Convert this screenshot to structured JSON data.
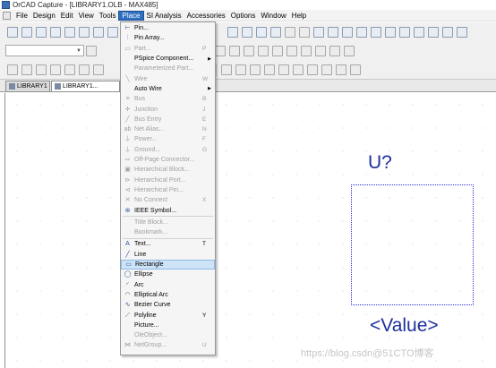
{
  "window": {
    "title": "OrCAD Capture - [LIBRARY1.OLB - MAX485]"
  },
  "menubar": [
    "File",
    "Design",
    "Edit",
    "View",
    "Tools",
    "Place",
    "SI Analysis",
    "Accessories",
    "Options",
    "Window",
    "Help"
  ],
  "tabs": [
    "LIBRARY1",
    "LIBRARY1..."
  ],
  "place_menu": [
    {
      "label": "Pin...",
      "shortcut": "",
      "enabled": true,
      "icon": "pin-icon"
    },
    {
      "label": "Pin Array...",
      "shortcut": "",
      "enabled": true,
      "icon": "pin-array-icon"
    },
    {
      "label": "Part...",
      "shortcut": "P",
      "enabled": false,
      "icon": "part-icon"
    },
    {
      "label": "PSpice Component...",
      "shortcut": "",
      "enabled": true,
      "icon": "",
      "submenu": true
    },
    {
      "label": "Parameterized Part...",
      "shortcut": "",
      "enabled": false,
      "icon": ""
    },
    {
      "label": "Wire",
      "shortcut": "W",
      "enabled": false,
      "icon": "wire-icon"
    },
    {
      "label": "Auto Wire",
      "shortcut": "",
      "enabled": true,
      "icon": "",
      "submenu": true
    },
    {
      "label": "Bus",
      "shortcut": "B",
      "enabled": false,
      "icon": "bus-icon"
    },
    {
      "label": "Junction",
      "shortcut": "J",
      "enabled": false,
      "icon": "junction-icon"
    },
    {
      "label": "Bus Entry",
      "shortcut": "E",
      "enabled": false,
      "icon": "bus-entry-icon"
    },
    {
      "label": "Net Alias...",
      "shortcut": "N",
      "enabled": false,
      "icon": "net-alias-icon"
    },
    {
      "label": "Power...",
      "shortcut": "F",
      "enabled": false,
      "icon": "power-icon"
    },
    {
      "label": "Ground...",
      "shortcut": "G",
      "enabled": false,
      "icon": "ground-icon"
    },
    {
      "label": "Off-Page Connector...",
      "shortcut": "",
      "enabled": false,
      "icon": "off-page-connector-icon"
    },
    {
      "label": "Hierarchical Block...",
      "shortcut": "",
      "enabled": false,
      "icon": "hierarchical-block-icon"
    },
    {
      "label": "Hierarchical Port...",
      "shortcut": "",
      "enabled": false,
      "icon": "hierarchical-port-icon"
    },
    {
      "label": "Hierarchical Pin...",
      "shortcut": "",
      "enabled": false,
      "icon": "hierarchical-pin-icon"
    },
    {
      "label": "No Connect",
      "shortcut": "X",
      "enabled": false,
      "icon": "no-connect-icon"
    },
    {
      "label": "IEEE Symbol...",
      "shortcut": "",
      "enabled": true,
      "icon": "ieee-symbol-icon"
    },
    {
      "sep": true
    },
    {
      "label": "Title Block...",
      "shortcut": "",
      "enabled": false,
      "icon": ""
    },
    {
      "label": "Bookmark...",
      "shortcut": "",
      "enabled": false,
      "icon": ""
    },
    {
      "sep": true
    },
    {
      "label": "Text...",
      "shortcut": "T",
      "enabled": true,
      "icon": "text-icon"
    },
    {
      "label": "Line",
      "shortcut": "",
      "enabled": true,
      "icon": "line-icon"
    },
    {
      "label": "Rectangle",
      "shortcut": "",
      "enabled": true,
      "icon": "rectangle-icon",
      "highlight": true
    },
    {
      "label": "Ellipse",
      "shortcut": "",
      "enabled": true,
      "icon": "ellipse-icon"
    },
    {
      "label": "Arc",
      "shortcut": "",
      "enabled": true,
      "icon": "arc-icon"
    },
    {
      "label": "Elliptical Arc",
      "shortcut": "",
      "enabled": true,
      "icon": "elliptical-arc-icon"
    },
    {
      "label": "Bezier Curve",
      "shortcut": "",
      "enabled": true,
      "icon": "bezier-curve-icon"
    },
    {
      "label": "Polyline",
      "shortcut": "Y",
      "enabled": true,
      "icon": "polyline-icon"
    },
    {
      "label": "Picture...",
      "shortcut": "",
      "enabled": true,
      "icon": ""
    },
    {
      "label": "OleObject...",
      "shortcut": "",
      "enabled": false,
      "icon": ""
    },
    {
      "label": "NetGroup...",
      "shortcut": "U",
      "enabled": false,
      "icon": "netgroup-icon"
    }
  ],
  "canvas": {
    "part_reference": "U?",
    "part_value": "<Value>"
  },
  "watermark": "https://blog.csdn@51CTO博客",
  "colors": {
    "menu_active": "#2f6fbf",
    "part_text": "#1d2f9a",
    "part_outline": "#2a2fd0",
    "menu_highlight": "#cde3f7"
  }
}
